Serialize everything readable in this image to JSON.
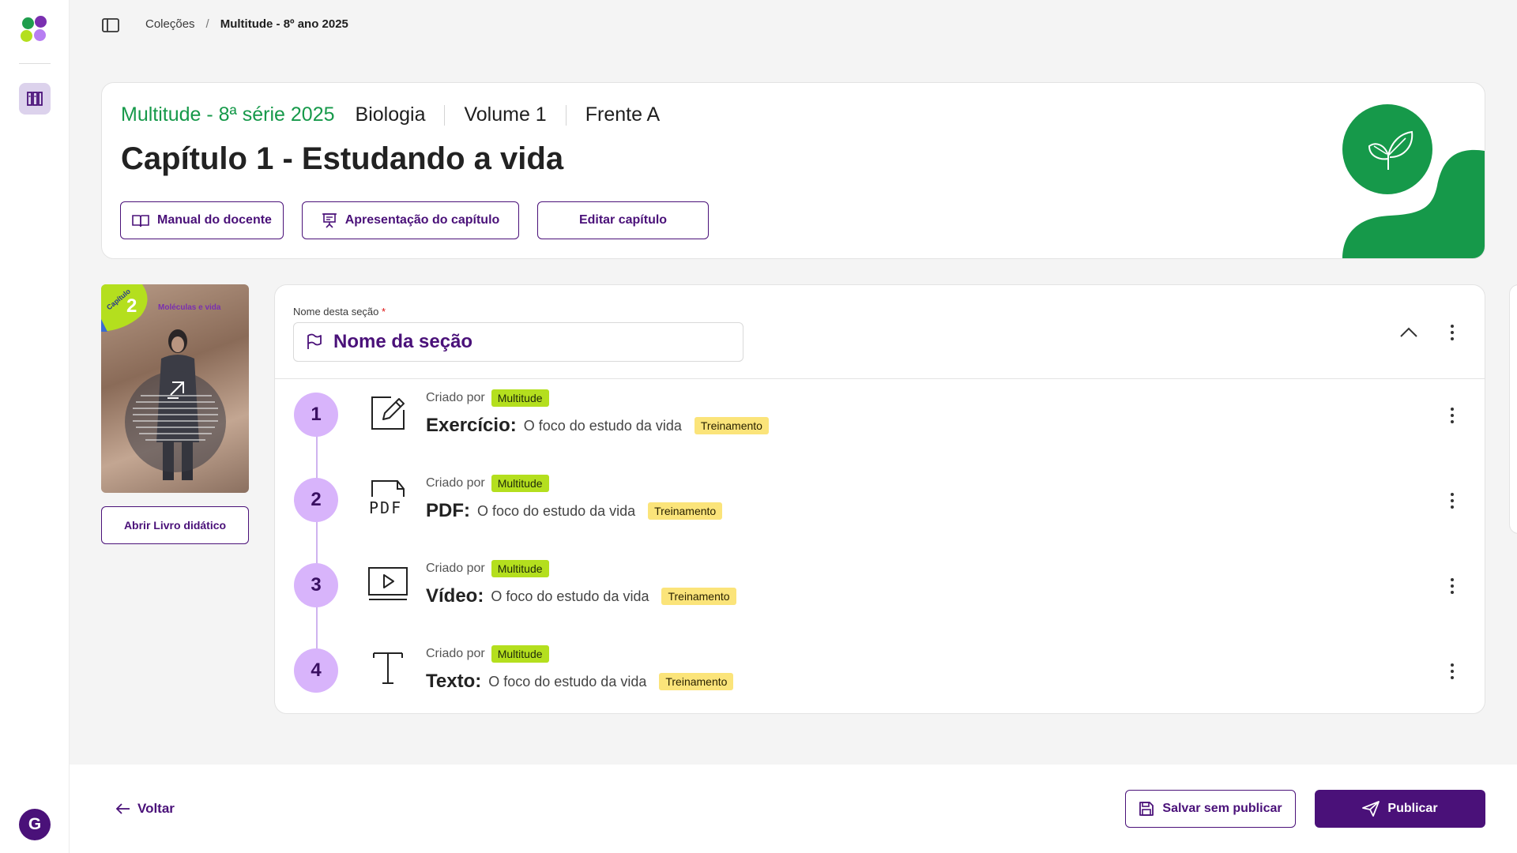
{
  "breadcrumb": {
    "root": "Coleções",
    "separator": "/",
    "current": "Multitude - 8º ano 2025"
  },
  "header": {
    "collection": "Multitude - 8ª série 2025",
    "subject": "Biologia",
    "volume": "Volume 1",
    "front": "Frente A",
    "title": "Capítulo 1 - Estudando a vida",
    "buttons": {
      "manual": "Manual do docente",
      "presentation": "Apresentação do capítulo",
      "edit": "Editar capítulo"
    }
  },
  "book": {
    "badge_label": "Capítulo",
    "badge_number": "2",
    "cover_title": "Moléculas e vida",
    "open_button": "Abrir Livro didático"
  },
  "section": {
    "label": "Nome desta seção",
    "required_mark": "*",
    "name": "Nome da seção",
    "items": [
      {
        "step": "1",
        "created_by_label": "Criado por",
        "author": "Multitude",
        "type": "Exercício:",
        "description": "O foco do estudo da vida",
        "tag": "Treinamento",
        "icon": "edit-square-icon"
      },
      {
        "step": "2",
        "created_by_label": "Criado por",
        "author": "Multitude",
        "type": "PDF:",
        "description": "O foco do estudo da vida",
        "tag": "Treinamento",
        "icon": "pdf-icon",
        "icon_text": "PDF"
      },
      {
        "step": "3",
        "created_by_label": "Criado por",
        "author": "Multitude",
        "type": "Vídeo:",
        "description": "O foco do estudo da vida",
        "tag": "Treinamento",
        "icon": "video-icon"
      },
      {
        "step": "4",
        "created_by_label": "Criado por",
        "author": "Multitude",
        "type": "Texto:",
        "description": "O foco do estudo da vida",
        "tag": "Treinamento",
        "icon": "text-icon"
      }
    ]
  },
  "footer": {
    "back": "Voltar",
    "save": "Salvar sem publicar",
    "publish": "Publicar"
  },
  "user": {
    "initial": "G"
  },
  "colors": {
    "primary": "#4a1179",
    "green": "#16994a",
    "step_bg": "#d8b4fb",
    "tag_green": "#b4df1e",
    "tag_yellow": "#fbe47a"
  }
}
